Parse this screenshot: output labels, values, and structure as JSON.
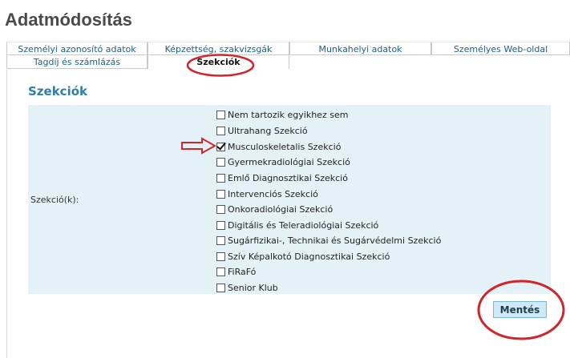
{
  "page": {
    "title": "Adatmódosítás"
  },
  "tabs": {
    "row1": [
      {
        "label": "Személyi azonosító adatok"
      },
      {
        "label": "Képzettség, szakvizsgák"
      },
      {
        "label": "Munkahelyi adatok"
      },
      {
        "label": "Személyes Web-oldal"
      }
    ],
    "row2": [
      {
        "label": "Tagdíj és számlázás"
      },
      {
        "label": "Szekciók",
        "active": true
      }
    ]
  },
  "section": {
    "heading": "Szekciók",
    "field_label": "Szekció(k):",
    "options": [
      {
        "label": "Nem tartozik egyikhez sem",
        "checked": false
      },
      {
        "label": "Ultrahang Szekció",
        "checked": false
      },
      {
        "label": "Musculoskeletalis Szekció",
        "checked": true
      },
      {
        "label": "Gyermekradiológiai Szekció",
        "checked": false
      },
      {
        "label": "Emlő Diagnosztikai Szekció",
        "checked": false
      },
      {
        "label": "Intervenciós Szekció",
        "checked": false
      },
      {
        "label": "Onkoradiológiai Szekció",
        "checked": false
      },
      {
        "label": "Digitális és Teleradiológiai Szekció",
        "checked": false
      },
      {
        "label": "Sugárfizikai-, Technikai és Sugárvédelmi Szekció",
        "checked": false
      },
      {
        "label": "Szív Képalkotó Diagnosztikai Szekció",
        "checked": false
      },
      {
        "label": "FiRaFó",
        "checked": false
      },
      {
        "label": "Senior Klub",
        "checked": false
      }
    ]
  },
  "actions": {
    "save_label": "Mentés"
  },
  "annotations": {
    "color": "#d0252b"
  }
}
